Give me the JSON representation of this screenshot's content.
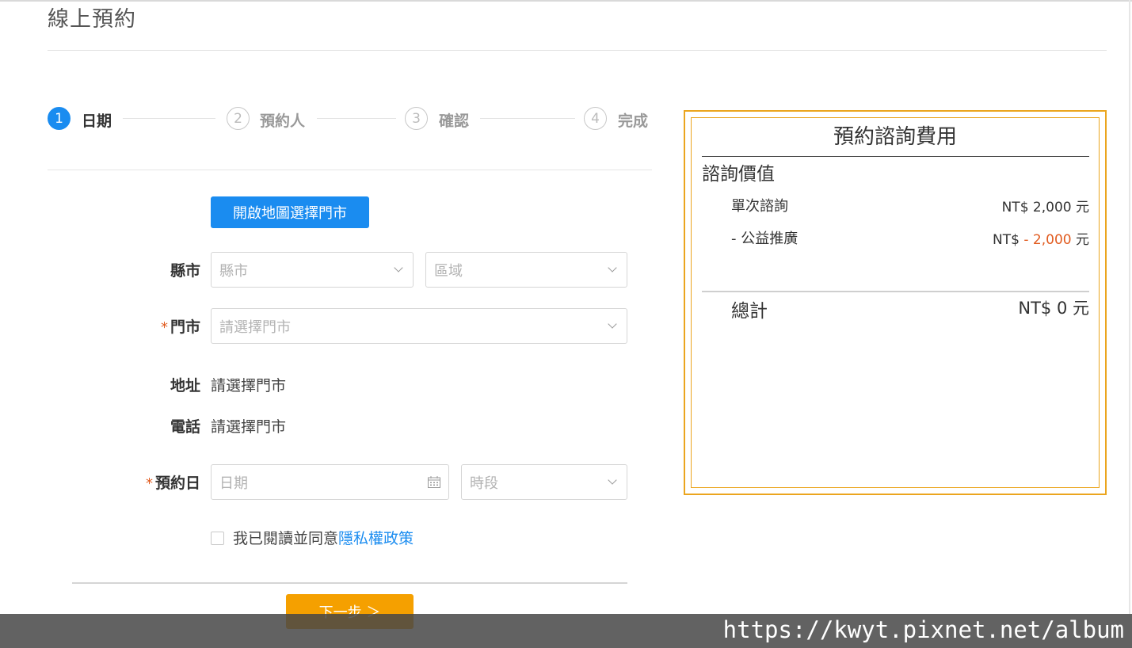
{
  "page": {
    "title": "線上預約"
  },
  "steps": [
    {
      "number": "1",
      "label": "日期",
      "active": true
    },
    {
      "number": "2",
      "label": "預約人",
      "active": false
    },
    {
      "number": "3",
      "label": "確認",
      "active": false
    },
    {
      "number": "4",
      "label": "完成",
      "active": false
    }
  ],
  "map_button": {
    "label": "開啟地圖選擇門市"
  },
  "form": {
    "county": {
      "label": "縣市",
      "placeholder": "縣市"
    },
    "district": {
      "placeholder": "區域"
    },
    "store": {
      "required_mark": "*",
      "label": "門市",
      "placeholder": "請選擇門市"
    },
    "address": {
      "label": "地址",
      "value": "請選擇門市"
    },
    "phone": {
      "label": "電話",
      "value": "請選擇門市"
    },
    "date": {
      "required_mark": "*",
      "label": "預約日",
      "placeholder": "日期"
    },
    "timeslot": {
      "placeholder": "時段"
    },
    "agree": {
      "text": "我已閱讀並同意",
      "link": "隱私權政策",
      "checked": false
    }
  },
  "next_button": {
    "label": "下一步 ＞"
  },
  "fee": {
    "title": "預約諮詢費用",
    "section": "諮詢價值",
    "rows": [
      {
        "label": "單次諮詢",
        "prefix": "NT$ ",
        "amount": "2,000",
        "suffix": " 元"
      },
      {
        "label": "- 公益推廣",
        "prefix": "NT$ ",
        "amount": "- 2,000",
        "suffix": " 元"
      }
    ],
    "total_label": "總計",
    "total_value": "NT$ 0 元"
  },
  "watermark": "https://kwyt.pixnet.net/album",
  "colors": {
    "primary": "#1a8cf0",
    "accent": "#f5a000",
    "fee_border": "#eba51e",
    "discount": "#e15b1f"
  }
}
